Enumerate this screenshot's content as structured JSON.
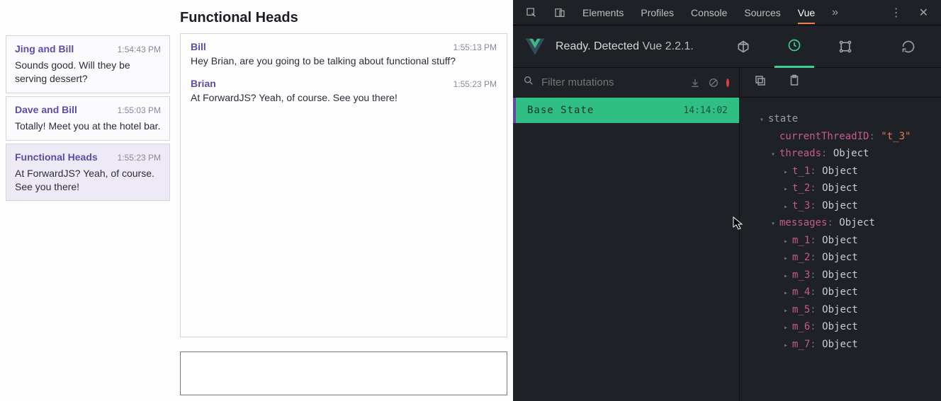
{
  "app": {
    "active_thread_title": "Functional Heads",
    "threads": [
      {
        "title": "Jing and Bill",
        "time": "1:54:43 PM",
        "snippet": "Sounds good. Will they be serving dessert?",
        "active": false
      },
      {
        "title": "Dave and Bill",
        "time": "1:55:03 PM",
        "snippet": "Totally! Meet you at the hotel bar.",
        "active": false
      },
      {
        "title": "Functional Heads",
        "time": "1:55:23 PM",
        "snippet": "At ForwardJS? Yeah, of course. See you there!",
        "active": true
      }
    ],
    "messages": [
      {
        "author": "Bill",
        "time": "1:55:13 PM",
        "body": "Hey Brian, are you going to be talking about functional stuff?"
      },
      {
        "author": "Brian",
        "time": "1:55:23 PM",
        "body": "At ForwardJS? Yeah, of course. See you there!"
      }
    ],
    "compose_placeholder": ""
  },
  "devtools": {
    "tabs": [
      "Elements",
      "Profiles",
      "Console",
      "Sources",
      "Vue"
    ],
    "active_tab": "Vue",
    "status_prefix": "Ready. Detected ",
    "status_version": "Vue 2.2.1.",
    "filter_placeholder": "Filter mutations",
    "mutations": [
      {
        "label": "Base State",
        "time": "14:14:02"
      }
    ],
    "state_label": "state",
    "state": {
      "currentThreadID": "\"t_3\"",
      "threads_label": "threads",
      "threads_type": "Object",
      "threads": [
        {
          "k": "t_1",
          "t": "Object"
        },
        {
          "k": "t_2",
          "t": "Object"
        },
        {
          "k": "t_3",
          "t": "Object"
        }
      ],
      "messages_label": "messages",
      "messages_type": "Object",
      "messages": [
        {
          "k": "m_1",
          "t": "Object"
        },
        {
          "k": "m_2",
          "t": "Object"
        },
        {
          "k": "m_3",
          "t": "Object"
        },
        {
          "k": "m_4",
          "t": "Object"
        },
        {
          "k": "m_5",
          "t": "Object"
        },
        {
          "k": "m_6",
          "t": "Object"
        },
        {
          "k": "m_7",
          "t": "Object"
        }
      ]
    }
  }
}
